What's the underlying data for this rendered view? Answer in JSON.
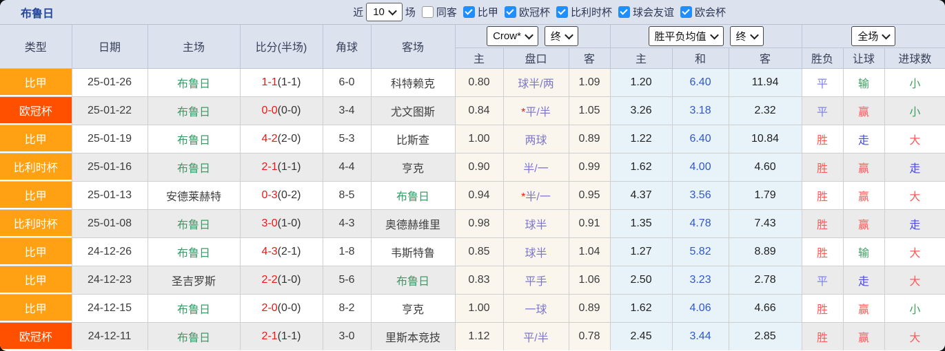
{
  "colors": {
    "league_badge_orange": "#ffa113",
    "league_badge_red": "#ff5000",
    "checkbox_blue": "#1f8fff",
    "win_red": "#ff5a5a",
    "lose_green": "#3f9e63",
    "draw_blue": "#8080f2",
    "walk_blue": "#4848e5",
    "score_red": "#f21616",
    "team_green": "#3c9a66",
    "handicap_purple": "#7e77c9",
    "avg_draw_blue": "#3157cd",
    "header_bg": "#dce3ee"
  },
  "topbar": {
    "title": "布鲁日",
    "recent_label": "近",
    "recent_value": "10",
    "matches_label": "场",
    "same_venue_label": "同客",
    "leagues": [
      "比甲",
      "欧冠杯",
      "比利时杯",
      "球会友谊",
      "欧会杯"
    ]
  },
  "table": {
    "columns": {
      "type": "类型",
      "date": "日期",
      "home": "主场",
      "score": "比分(半场)",
      "corner": "角球",
      "away": "客场"
    },
    "dropdowns": {
      "odds_source": "Crow*",
      "odds_time": "终",
      "avg_source": "胜平负均值",
      "avg_time": "终",
      "scope": "全场"
    },
    "subheaders": {
      "odds_home": "主",
      "handicap": "盘口",
      "odds_away": "客",
      "avg_home": "主",
      "avg_draw": "和",
      "avg_away": "客",
      "result_wdl": "胜负",
      "result_handicap": "让球",
      "result_goals": "进球数"
    },
    "rows": [
      {
        "type": "比甲",
        "date": "25-01-26",
        "home": "布鲁日",
        "score_ft": "1-1",
        "score_ht": "(1-1)",
        "corner": "6-0",
        "away": "科特赖克",
        "odds_home": "0.80",
        "star": "",
        "handicap": "球半/两",
        "odds_away": "1.09",
        "avg_home": "1.20",
        "avg_draw": "6.40",
        "avg_away": "11.94",
        "result_wdl": "平",
        "result_handicap": "输",
        "result_goals": "小"
      },
      {
        "type": "欧冠杯",
        "date": "25-01-22",
        "home": "布鲁日",
        "score_ft": "0-0",
        "score_ht": "(0-0)",
        "corner": "3-4",
        "away": "尤文图斯",
        "odds_home": "0.84",
        "star": "*",
        "handicap": "平/半",
        "odds_away": "1.05",
        "avg_home": "3.26",
        "avg_draw": "3.18",
        "avg_away": "2.32",
        "result_wdl": "平",
        "result_handicap": "赢",
        "result_goals": "小"
      },
      {
        "type": "比甲",
        "date": "25-01-19",
        "home": "布鲁日",
        "score_ft": "4-2",
        "score_ht": "(2-0)",
        "corner": "5-3",
        "away": "比斯查",
        "odds_home": "1.00",
        "star": "",
        "handicap": "两球",
        "odds_away": "0.89",
        "avg_home": "1.22",
        "avg_draw": "6.40",
        "avg_away": "10.84",
        "result_wdl": "胜",
        "result_handicap": "走",
        "result_goals": "大"
      },
      {
        "type": "比利时杯",
        "date": "25-01-16",
        "home": "布鲁日",
        "score_ft": "2-1",
        "score_ht": "(1-1)",
        "corner": "4-4",
        "away": "亨克",
        "odds_home": "0.90",
        "star": "",
        "handicap": "半/一",
        "odds_away": "0.99",
        "avg_home": "1.62",
        "avg_draw": "4.00",
        "avg_away": "4.60",
        "result_wdl": "胜",
        "result_handicap": "赢",
        "result_goals": "走"
      },
      {
        "type": "比甲",
        "date": "25-01-13",
        "home": "安德莱赫特",
        "score_ft": "0-3",
        "score_ht": "(0-2)",
        "corner": "8-5",
        "away": "布鲁日",
        "odds_home": "0.94",
        "star": "*",
        "handicap": "半/一",
        "odds_away": "0.95",
        "avg_home": "4.37",
        "avg_draw": "3.56",
        "avg_away": "1.79",
        "result_wdl": "胜",
        "result_handicap": "赢",
        "result_goals": "大"
      },
      {
        "type": "比利时杯",
        "date": "25-01-08",
        "home": "布鲁日",
        "score_ft": "3-0",
        "score_ht": "(1-0)",
        "corner": "4-3",
        "away": "奥德赫维里",
        "odds_home": "0.98",
        "star": "",
        "handicap": "球半",
        "odds_away": "0.91",
        "avg_home": "1.35",
        "avg_draw": "4.78",
        "avg_away": "7.43",
        "result_wdl": "胜",
        "result_handicap": "赢",
        "result_goals": "走"
      },
      {
        "type": "比甲",
        "date": "24-12-26",
        "home": "布鲁日",
        "score_ft": "4-3",
        "score_ht": "(2-1)",
        "corner": "1-8",
        "away": "韦斯特鲁",
        "odds_home": "0.85",
        "star": "",
        "handicap": "球半",
        "odds_away": "1.04",
        "avg_home": "1.27",
        "avg_draw": "5.82",
        "avg_away": "8.89",
        "result_wdl": "胜",
        "result_handicap": "输",
        "result_goals": "大"
      },
      {
        "type": "比甲",
        "date": "24-12-23",
        "home": "圣吉罗斯",
        "score_ft": "2-2",
        "score_ht": "(1-0)",
        "corner": "5-6",
        "away": "布鲁日",
        "odds_home": "0.83",
        "star": "",
        "handicap": "平手",
        "odds_away": "1.06",
        "avg_home": "2.50",
        "avg_draw": "3.23",
        "avg_away": "2.78",
        "result_wdl": "平",
        "result_handicap": "走",
        "result_goals": "大"
      },
      {
        "type": "比甲",
        "date": "24-12-15",
        "home": "布鲁日",
        "score_ft": "2-0",
        "score_ht": "(0-0)",
        "corner": "8-2",
        "away": "亨克",
        "odds_home": "1.00",
        "star": "",
        "handicap": "一球",
        "odds_away": "0.89",
        "avg_home": "1.62",
        "avg_draw": "4.06",
        "avg_away": "4.66",
        "result_wdl": "胜",
        "result_handicap": "赢",
        "result_goals": "小"
      },
      {
        "type": "欧冠杯",
        "date": "24-12-11",
        "home": "布鲁日",
        "score_ft": "2-1",
        "score_ht": "(1-1)",
        "corner": "3-0",
        "away": "里斯本竞技",
        "odds_home": "1.12",
        "star": "",
        "handicap": "平/半",
        "odds_away": "0.78",
        "avg_home": "2.45",
        "avg_draw": "3.44",
        "avg_away": "2.85",
        "result_wdl": "胜",
        "result_handicap": "赢",
        "result_goals": "大"
      }
    ]
  }
}
